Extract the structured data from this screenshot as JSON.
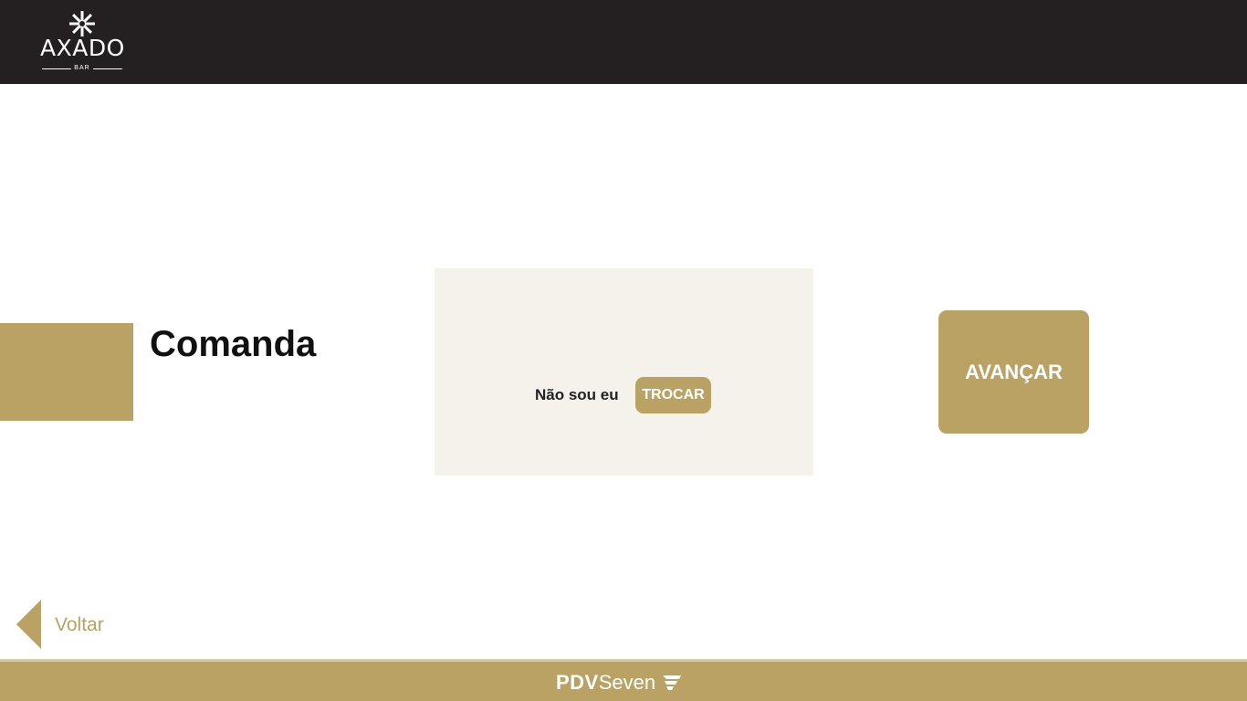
{
  "header": {
    "logo": {
      "name": "AXADO",
      "subtitle": "BAR"
    },
    "background_color": "#242021"
  },
  "main": {
    "title": "Comanda",
    "panel": {
      "not_me_text": "Não sou eu",
      "change_button": "TROCAR"
    },
    "advance_button": "AVANÇAR"
  },
  "navigation": {
    "back_label": "Voltar",
    "back_icon": "triangle-left-icon"
  },
  "footer": {
    "brand_strong": "PDV",
    "brand_light": "Seven",
    "brand_icon": "pdvseven-mark-icon"
  },
  "colors": {
    "accent": "#b9a264",
    "panel": "#f5f2eb",
    "text_dark": "#111111",
    "white": "#ffffff"
  }
}
